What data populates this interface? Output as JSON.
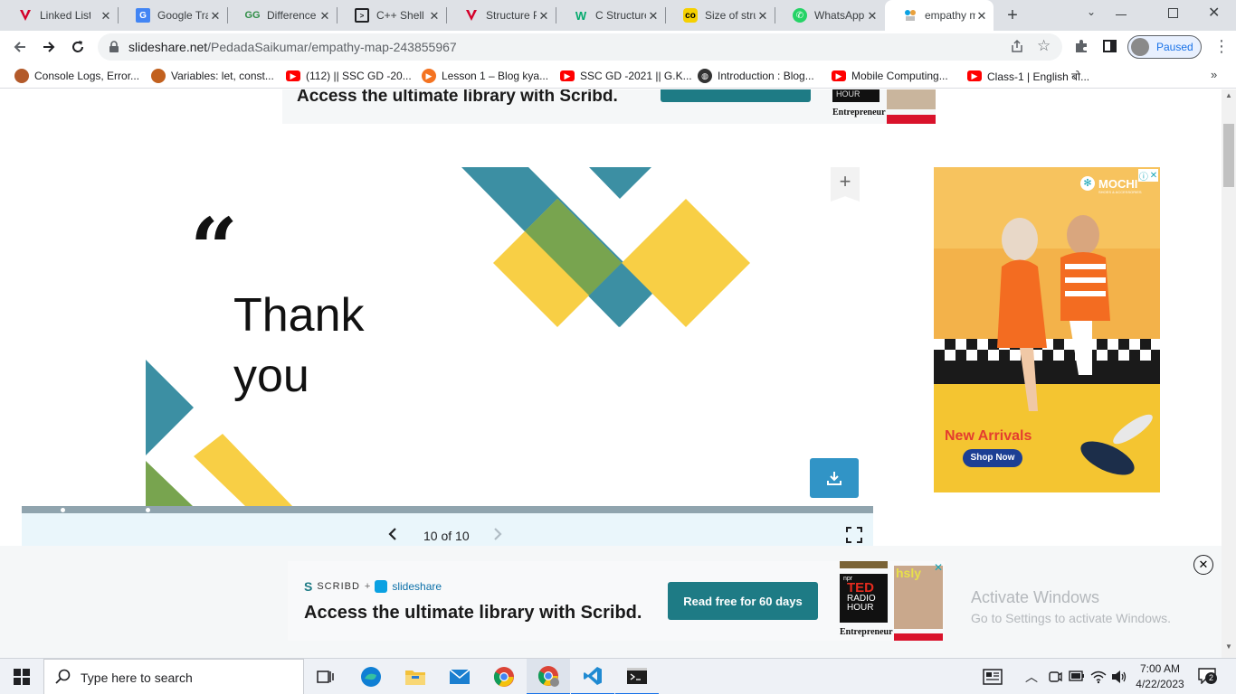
{
  "tabs": [
    {
      "title": "Linked List",
      "favicon": "tutorial-v-icon",
      "color": "#d4002a"
    },
    {
      "title": "Google Translate",
      "favicon": "google-translate-icon",
      "color": "#4285f4"
    },
    {
      "title": "Difference",
      "favicon": "gfg-icon",
      "color": "#2f8d46"
    },
    {
      "title": "C++ Shell",
      "favicon": "terminal-icon",
      "color": "#202124"
    },
    {
      "title": "Structure P",
      "favicon": "tutorial-v-icon",
      "color": "#d4002a"
    },
    {
      "title": "C Structure",
      "favicon": "w-icon",
      "color": "#04aa6d"
    },
    {
      "title": "Size of stru",
      "favicon": "codechef-icon",
      "color": "#f5d000"
    },
    {
      "title": "WhatsApp",
      "favicon": "whatsapp-icon",
      "color": "#25d366"
    },
    {
      "title": "empathy m",
      "favicon": "slideshare-icon",
      "color": "#0aa1e2"
    }
  ],
  "newtab_label": "+",
  "toolbar": {
    "url_host": "slideshare.net",
    "url_path": "/PedadaSaikumar/empathy-map-243855967",
    "profile_label": "Paused"
  },
  "bookmarks": [
    {
      "label": "Console Logs, Error...",
      "icon": "avatar-icon",
      "color": "#b35a2a"
    },
    {
      "label": "Variables: let, const...",
      "icon": "avatar-icon",
      "color": "#c2611f"
    },
    {
      "label": "(112) || SSC GD -20...",
      "icon": "youtube-icon",
      "color": "#ff0000"
    },
    {
      "label": "Lesson 1 – Blog kya...",
      "icon": "play-circle-icon",
      "color": "#f47321"
    },
    {
      "label": "SSC GD -2021 || G.K...",
      "icon": "youtube-icon",
      "color": "#ff0000"
    },
    {
      "label": "Introduction : Blog...",
      "icon": "globe-icon",
      "color": "#333333"
    },
    {
      "label": "Mobile Computing...",
      "icon": "youtube-icon",
      "color": "#ff0000"
    },
    {
      "label": "Class-1 | English बो...",
      "icon": "youtube-icon",
      "color": "#ff0000"
    }
  ],
  "top_banner": {
    "headline": "Access the ultimate library with Scribd.",
    "entrepreneur": "Entrepreneur",
    "hour": "HOUR"
  },
  "slide": {
    "quote_mark": "“",
    "text_line1": "Thank",
    "text_line2": "you",
    "counter": "10 of 10",
    "add_label": "+"
  },
  "ad": {
    "brand": "MOCHI",
    "brand_sub": "SHOES & ACCESSORIES",
    "headline": "New Arrivals",
    "cta": "Shop Now"
  },
  "bottom_banner": {
    "scribd": "SCRIBD",
    "plus": "+",
    "slideshare": "slideshare",
    "headline": "Access the ultimate library with Scribd.",
    "cta": "Read free for 60 days",
    "ted_top": "npr",
    "ted_main": "TED",
    "ted_sub1": "RADIO",
    "ted_sub2": "HOUR",
    "entrepreneur": "Entrepreneur",
    "mag_title": "hsly"
  },
  "watermark": {
    "line1": "Activate Windows",
    "line2": "Go to Settings to activate Windows."
  },
  "taskbar": {
    "search_placeholder": "Type here to search",
    "time": "7:00 AM",
    "date": "4/22/2023",
    "notif_count": "2"
  },
  "colors": {
    "teal": "#3c8fa3",
    "yellow": "#f8cf45",
    "green": "#78a44f",
    "progress_track": "#90a4ae",
    "slide_panel": "#eaf6fb",
    "scribd_btn": "#1e7b85",
    "download_btn": "#3194c6"
  },
  "progress": {
    "position": 1.0
  }
}
